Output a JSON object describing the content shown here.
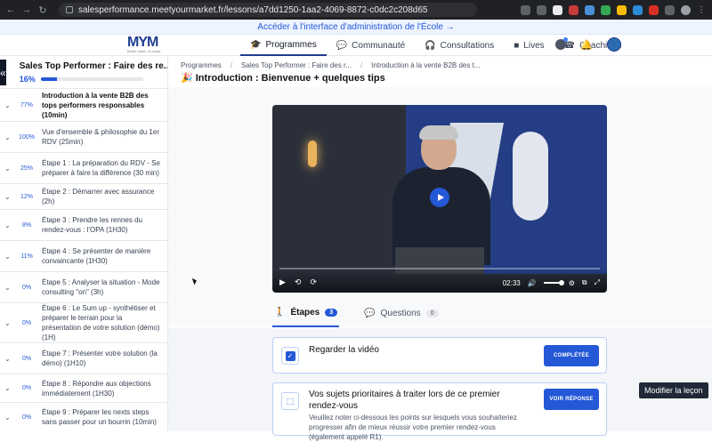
{
  "browser": {
    "url": "salesperformance.meetyourmarket.fr/lessons/a7dd1250-1aa2-4069-8872-c0dc2c208d65"
  },
  "announce": {
    "text": "Accéder à l'interface d'administration de l'École →"
  },
  "brand": {
    "logo_text": "MYM",
    "tagline": "Better sales. At scale."
  },
  "nav": {
    "items": [
      {
        "label": "Programmes",
        "icon": "graduation-cap-icon",
        "active": true
      },
      {
        "label": "Communauté",
        "icon": "chat-icon",
        "active": false
      },
      {
        "label": "Consultations",
        "icon": "headset-icon",
        "active": false
      },
      {
        "label": "Lives",
        "icon": "video-icon",
        "active": false
      },
      {
        "label": "Coachings",
        "icon": "phone-icon",
        "active": false
      }
    ]
  },
  "sidebar": {
    "course_title": "Sales Top Performer : Faire des re...",
    "progress_label": "16%",
    "progress": 0.16,
    "lessons": [
      {
        "pct": "77%",
        "title": "Introduction à la vente B2B des tops performers responsables (10min)",
        "current": true
      },
      {
        "pct": "100%",
        "title": "Vue d'ensemble & philosophie du 1er RDV (25min)"
      },
      {
        "pct": "25%",
        "title": "Étape 1 : La préparation du RDV - Se préparer à faire la différence (30 min)"
      },
      {
        "pct": "12%",
        "title": "Étape 2 : Démarrer avec assurance (2h)"
      },
      {
        "pct": "8%",
        "title": "Étape 3 : Prendre les rennes du rendez-vous : l'OPA (1H30)"
      },
      {
        "pct": "11%",
        "title": "Étape 4 : Se présenter de manière convaincante (1H30)"
      },
      {
        "pct": "0%",
        "title": "Étape 5 : Analyser la situation - Mode consulting \"on\" (3h)"
      },
      {
        "pct": "0%",
        "title": "Étape 6 : Le Sum up - synthétiser et préparer le terrain pour la présentation de votre solution (démo) (1H)"
      },
      {
        "pct": "0%",
        "title": "Étape 7 : Présenter votre solution (la démo) (1H10)"
      },
      {
        "pct": "0%",
        "title": "Étape 8 : Répondre aux objections immédiatement (1H30)"
      },
      {
        "pct": "0%",
        "title": "Étape 9 : Préparer les nexts steps sans passer pour un bourrin (10min)"
      }
    ]
  },
  "main": {
    "breadcrumbs": [
      "Programmes",
      "Sales Top Performer : Faire des r...",
      "Introduction à la vente B2B des t..."
    ],
    "lesson_title": "🎉 Introduction : Bienvenue + quelques tips",
    "video": {
      "time": "02:33"
    },
    "tabs": [
      {
        "label": "Étapes",
        "count": "3",
        "icon": "steps-icon",
        "active": true
      },
      {
        "label": "Questions",
        "count": "0",
        "icon": "question-icon",
        "active": false
      }
    ],
    "steps": [
      {
        "title": "Regarder la vidéo",
        "button": "COMPLÉTÉE",
        "checked": true
      },
      {
        "title": "Vos sujets prioritaires à traiter lors de ce premier rendez-vous",
        "desc": "Veuillez noter ci-dessous les points sur lesquels vous souhaiteriez progresser afin de mieux réussir votre premier rendez-vous (également appelé R1).",
        "button": "VOIR RÉPONSE"
      }
    ]
  },
  "tooltip": {
    "text": "Modifier la leçon"
  },
  "colors": {
    "accent": "#2458d6",
    "dark": "#111827"
  }
}
